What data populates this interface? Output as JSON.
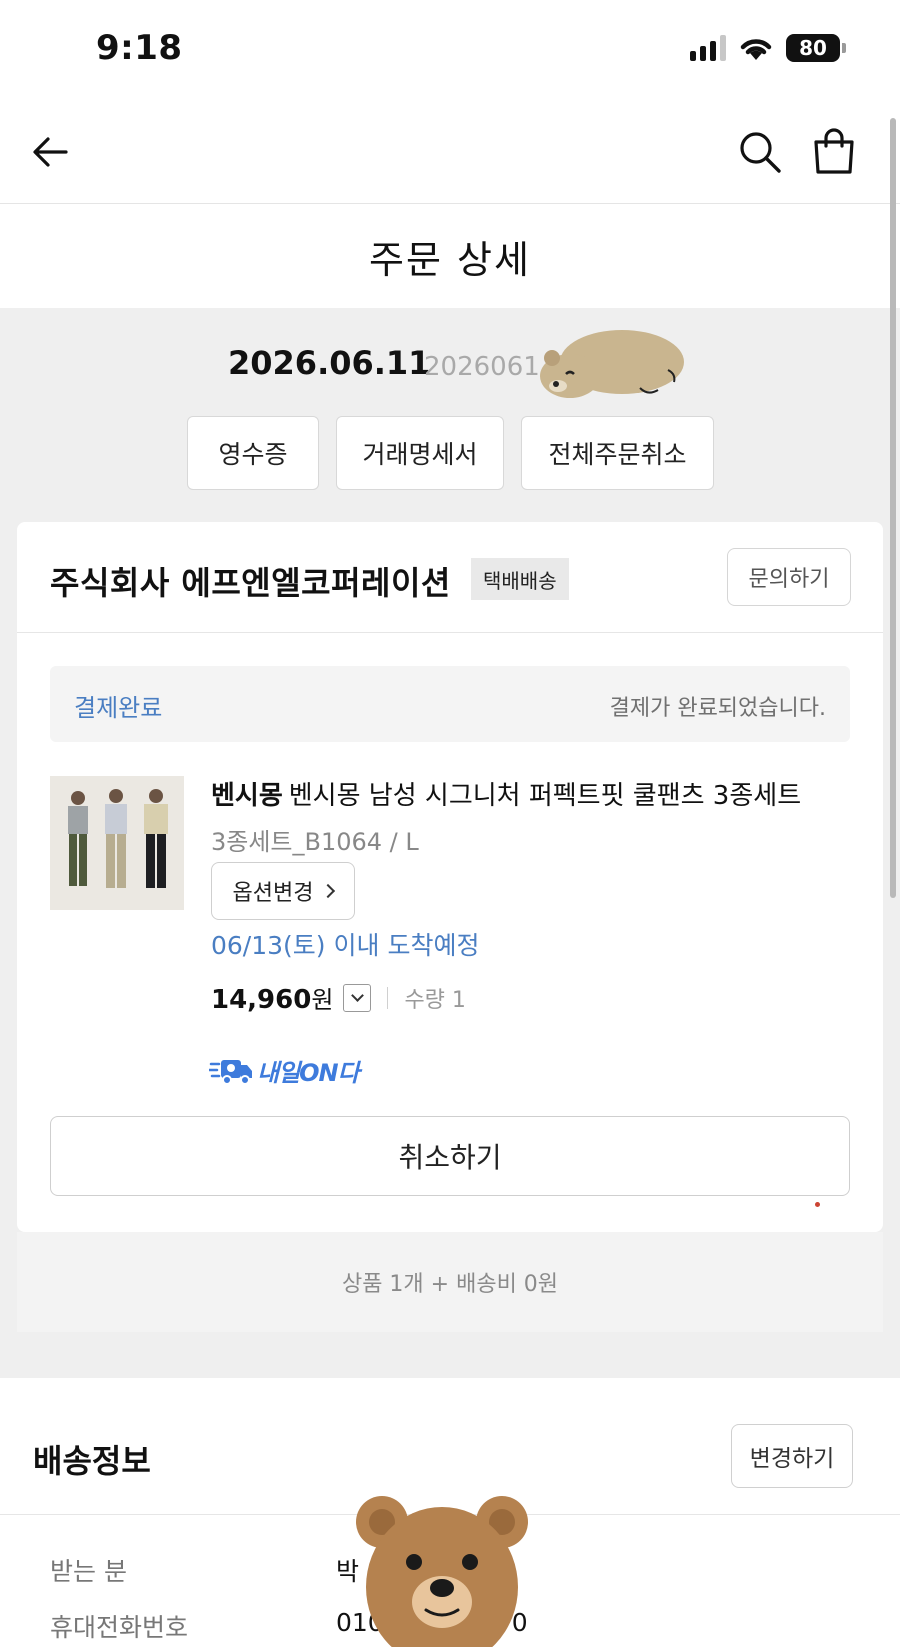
{
  "status_bar": {
    "time": "9:18",
    "battery": "80"
  },
  "nav": {
    "icons": [
      "back-arrow-icon",
      "search-icon",
      "shopping-bag-icon"
    ]
  },
  "page": {
    "title": "주문 상세"
  },
  "order": {
    "date": "2026.06.11",
    "number_partial": "2026061",
    "buttons": {
      "receipt": "영수증",
      "statement": "거래명세서",
      "cancel_all": "전체주문취소"
    }
  },
  "seller": {
    "name": "주식회사 에프엔엘코퍼레이션",
    "delivery_type": "택배배송",
    "inquiry_label": "문의하기",
    "payment": {
      "status": "결제완료",
      "message": "결제가 완료되었습니다."
    },
    "product": {
      "brand": "벤시몽",
      "name": "벤시몽 남성 시그니처 퍼펙트핏 쿨팬츠 3종세트",
      "option": "3종세트_B1064 / L",
      "option_change_label": "옵션변경",
      "arrival": "06/13(토) 이내 도착예정",
      "price": "14,960",
      "price_unit": "원",
      "quantity": "수량 1",
      "badge": "내일ON다"
    },
    "cancel_label": "취소하기",
    "summary": "상품 1개 + 배송비 0원"
  },
  "shipping": {
    "title": "배송정보",
    "change_label": "변경하기",
    "recipient_label": "받는 분",
    "recipient_value_partial": "박",
    "phone_label": "휴대전화번호",
    "phone_value_partial_start": "010",
    "phone_value_partial_end": "0"
  },
  "colors": {
    "accent_blue": "#4a7ec2",
    "badge_blue": "#3e7bdc",
    "background_gray": "#efefef"
  }
}
